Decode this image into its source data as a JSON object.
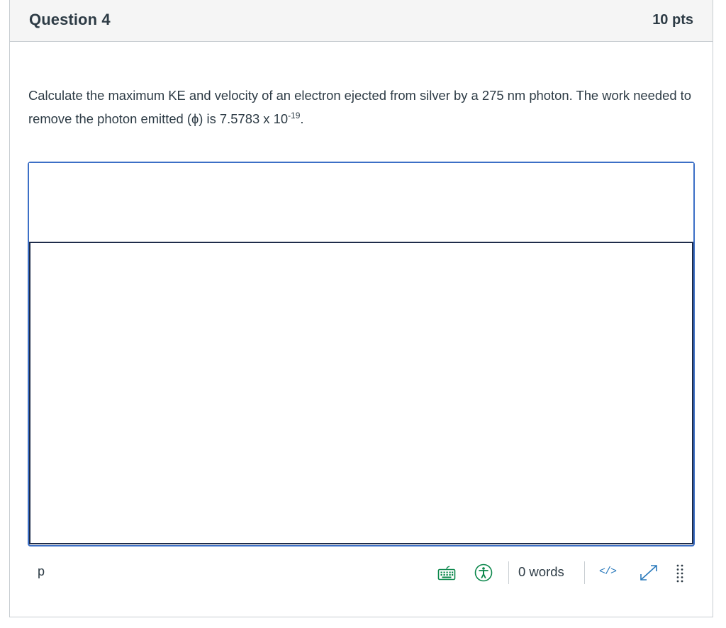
{
  "question": {
    "title": "Question 4",
    "points": "10 pts",
    "text_before_sup": "Calculate the maximum KE and velocity of an electron ejected from silver by a 275 nm photon. The work needed to remove the photon emitted (ϕ) is 7.5783 x 10",
    "exponent": "-19",
    "text_after_sup": "."
  },
  "editor": {
    "body_text": "",
    "path": "p",
    "word_count": "0 words",
    "html_toggle_label": "</>",
    "icons": {
      "keyboard": "keyboard-icon",
      "accessibility": "accessibility-checker-icon",
      "fullscreen": "fullscreen-expand-icon",
      "drag": "resize-drag-handle-icon"
    }
  },
  "colors": {
    "header_bg": "#f5f5f5",
    "border": "#c7cdd1",
    "focus_border": "#3c6fc6",
    "text": "#2d3b45",
    "link": "#2b7abc",
    "icon_green": "#0b874b"
  }
}
